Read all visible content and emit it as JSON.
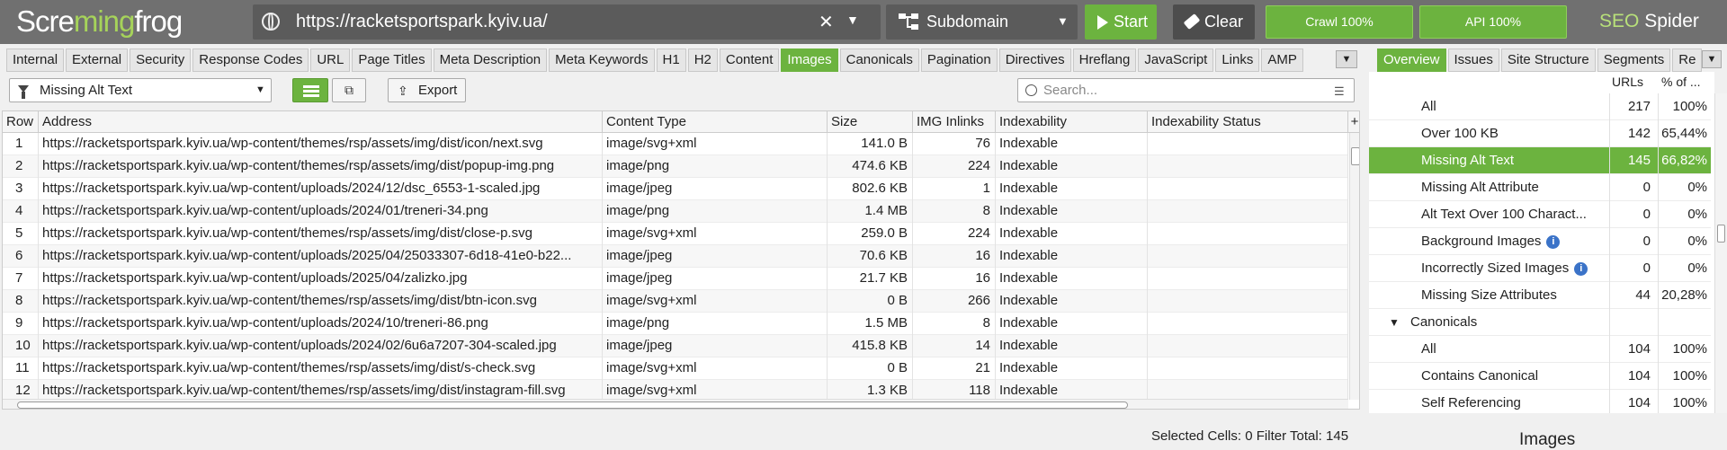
{
  "topbar": {
    "logo_pre": "Scre",
    "logo_mid": "ming",
    "logo_post": "frog",
    "url": "https://racketsportspark.kyiv.ua/",
    "mode": "Subdomain",
    "start_label": "Start",
    "clear_label": "Clear",
    "crawl_label": "Crawl 100%",
    "api_label": "API 100%",
    "product_a": "SEO",
    "product_b": "Spider",
    "accent_color": "#6cb33f"
  },
  "tabs": [
    "Internal",
    "External",
    "Security",
    "Response Codes",
    "URL",
    "Page Titles",
    "Meta Description",
    "Meta Keywords",
    "H1",
    "H2",
    "Content",
    "Images",
    "Canonicals",
    "Pagination",
    "Directives",
    "Hreflang",
    "JavaScript",
    "Links",
    "AMP"
  ],
  "active_tab": "Images",
  "right_tabs": [
    "Overview",
    "Issues",
    "Site Structure",
    "Segments",
    "Re"
  ],
  "toolbar": {
    "filter_value": "Missing Alt Text",
    "export_label": "Export",
    "search_placeholder": "Search..."
  },
  "table": {
    "columns": [
      "Row",
      "Address",
      "Content Type",
      "Size",
      "IMG Inlinks",
      "Indexability",
      "Indexability Status"
    ],
    "rows": [
      [
        "1",
        "https://racketsportspark.kyiv.ua/wp-content/themes/rsp/assets/img/dist/icon/next.svg",
        "image/svg+xml",
        "141.0 B",
        "76",
        "Indexable",
        ""
      ],
      [
        "2",
        "https://racketsportspark.kyiv.ua/wp-content/themes/rsp/assets/img/dist/popup-img.png",
        "image/png",
        "474.6 KB",
        "224",
        "Indexable",
        ""
      ],
      [
        "3",
        "https://racketsportspark.kyiv.ua/wp-content/uploads/2024/12/dsc_6553-1-scaled.jpg",
        "image/jpeg",
        "802.6 KB",
        "1",
        "Indexable",
        ""
      ],
      [
        "4",
        "https://racketsportspark.kyiv.ua/wp-content/uploads/2024/01/treneri-34.png",
        "image/png",
        "1.4 MB",
        "8",
        "Indexable",
        ""
      ],
      [
        "5",
        "https://racketsportspark.kyiv.ua/wp-content/themes/rsp/assets/img/dist/close-p.svg",
        "image/svg+xml",
        "259.0 B",
        "224",
        "Indexable",
        ""
      ],
      [
        "6",
        "https://racketsportspark.kyiv.ua/wp-content/uploads/2025/04/25033307-6d18-41e0-b22...",
        "image/jpeg",
        "70.6 KB",
        "16",
        "Indexable",
        ""
      ],
      [
        "7",
        "https://racketsportspark.kyiv.ua/wp-content/uploads/2025/04/zalizko.jpg",
        "image/jpeg",
        "21.7 KB",
        "16",
        "Indexable",
        ""
      ],
      [
        "8",
        "https://racketsportspark.kyiv.ua/wp-content/themes/rsp/assets/img/dist/btn-icon.svg",
        "image/svg+xml",
        "0 B",
        "266",
        "Indexable",
        ""
      ],
      [
        "9",
        "https://racketsportspark.kyiv.ua/wp-content/uploads/2024/10/treneri-86.png",
        "image/png",
        "1.5 MB",
        "8",
        "Indexable",
        ""
      ],
      [
        "10",
        "https://racketsportspark.kyiv.ua/wp-content/uploads/2024/02/6u6a7207-304-scaled.jpg",
        "image/jpeg",
        "415.8 KB",
        "14",
        "Indexable",
        ""
      ],
      [
        "11",
        "https://racketsportspark.kyiv.ua/wp-content/themes/rsp/assets/img/dist/s-check.svg",
        "image/svg+xml",
        "0 B",
        "21",
        "Indexable",
        ""
      ],
      [
        "12",
        "https://racketsportspark.kyiv.ua/wp-content/themes/rsp/assets/img/dist/instagram-fill.svg",
        "image/svg+xml",
        "1.3 KB",
        "118",
        "Indexable",
        ""
      ]
    ]
  },
  "status": {
    "selected_label": "Selected Cells:",
    "selected_value": "0",
    "filter_label": "Filter Total:",
    "filter_value": "145"
  },
  "overview": {
    "col_urls": "URLs",
    "col_pct": "% of ...",
    "rows": [
      {
        "label": "All",
        "urls": "217",
        "pct": "100%"
      },
      {
        "label": "Over 100 KB",
        "urls": "142",
        "pct": "65,44%"
      },
      {
        "label": "Missing Alt Text",
        "urls": "145",
        "pct": "66,82%",
        "selected": true
      },
      {
        "label": "Missing Alt Attribute",
        "urls": "0",
        "pct": "0%"
      },
      {
        "label": "Alt Text Over 100 Charact...",
        "urls": "0",
        "pct": "0%"
      },
      {
        "label": "Background Images",
        "urls": "0",
        "pct": "0%",
        "info": true
      },
      {
        "label": "Incorrectly Sized Images",
        "urls": "0",
        "pct": "0%",
        "info": true
      },
      {
        "label": "Missing Size Attributes",
        "urls": "44",
        "pct": "20,28%"
      },
      {
        "label": "Canonicals",
        "urls": "",
        "pct": "",
        "section": true
      },
      {
        "label": "All",
        "urls": "104",
        "pct": "100%"
      },
      {
        "label": "Contains Canonical",
        "urls": "104",
        "pct": "100%"
      },
      {
        "label": "Self Referencing",
        "urls": "104",
        "pct": "100%"
      }
    ],
    "panel_title": "Images"
  }
}
